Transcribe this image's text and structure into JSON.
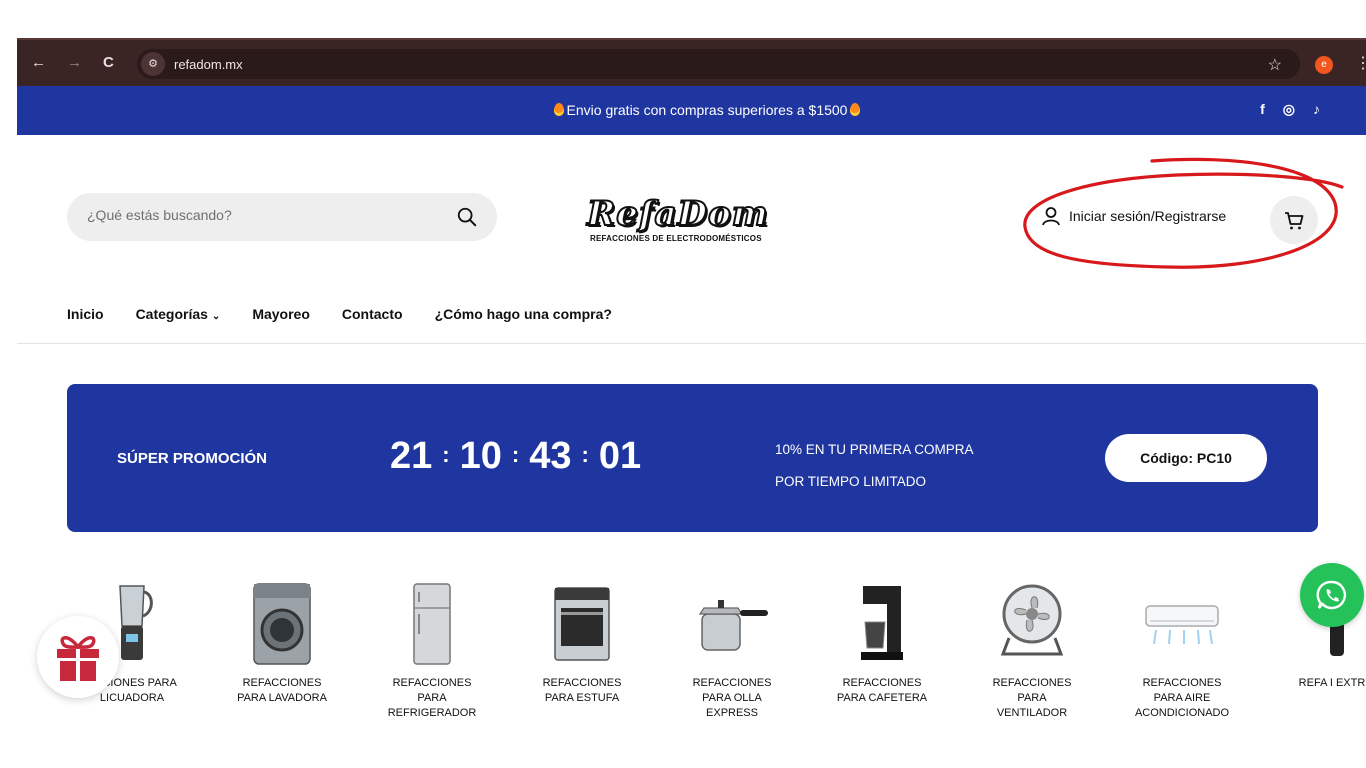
{
  "browser": {
    "url": "refadom.mx",
    "profile_initial": "e",
    "back": "←",
    "forward": "→",
    "reload": "C",
    "star": "☆",
    "menu": "⋮"
  },
  "promo_bar": {
    "text": "Envio gratis con compras superiores a $1500",
    "socials": [
      "f",
      "◎",
      "♪"
    ]
  },
  "search": {
    "placeholder": "¿Qué estás buscando?"
  },
  "logo": {
    "wordmark": "RefaDom",
    "tagline": "REFACCIONES DE ELECTRODOMÉSTICOS"
  },
  "account": {
    "login_label": "Iniciar sesión/Registrarse"
  },
  "menu": {
    "items": [
      "Inicio",
      "Categorías",
      "Mayoreo",
      "Contacto",
      "¿Cómo hago una compra?"
    ],
    "dropdown_chevron": "⌄"
  },
  "banner": {
    "title": "SÚPER PROMOCIÓN",
    "countdown": [
      "21",
      "10",
      "43",
      "01"
    ],
    "separator": ":",
    "offer_line1": "10% EN TU PRIMERA COMPRA",
    "offer_line2": "POR TIEMPO LIMITADO",
    "code_label": "Código: PC10"
  },
  "categories": [
    {
      "label": "ACCIONES PARA LICUADORA",
      "icon": "blender-icon"
    },
    {
      "label": "REFACCIONES PARA LAVADORA",
      "icon": "washer-icon"
    },
    {
      "label": "REFACCIONES PARA REFRIGERADOR",
      "icon": "fridge-icon"
    },
    {
      "label": "REFACCIONES PARA ESTUFA",
      "icon": "stove-icon"
    },
    {
      "label": "REFACCIONES PARA OLLA EXPRESS",
      "icon": "pressure-cooker-icon"
    },
    {
      "label": "REFACCIONES PARA CAFETERA",
      "icon": "coffee-maker-icon"
    },
    {
      "label": "REFACCIONES PARA VENTILADOR",
      "icon": "fan-icon"
    },
    {
      "label": "REFACCIONES PARA AIRE ACONDICIONADO",
      "icon": "air-conditioner-icon"
    },
    {
      "label": "REFA I EXTR",
      "icon": "extractor-icon"
    }
  ],
  "colors": {
    "brand_blue": "#1f36a0",
    "annotation_red": "#d7191c",
    "whatsapp_green": "#25c25a",
    "gift_red": "#c8283c"
  }
}
